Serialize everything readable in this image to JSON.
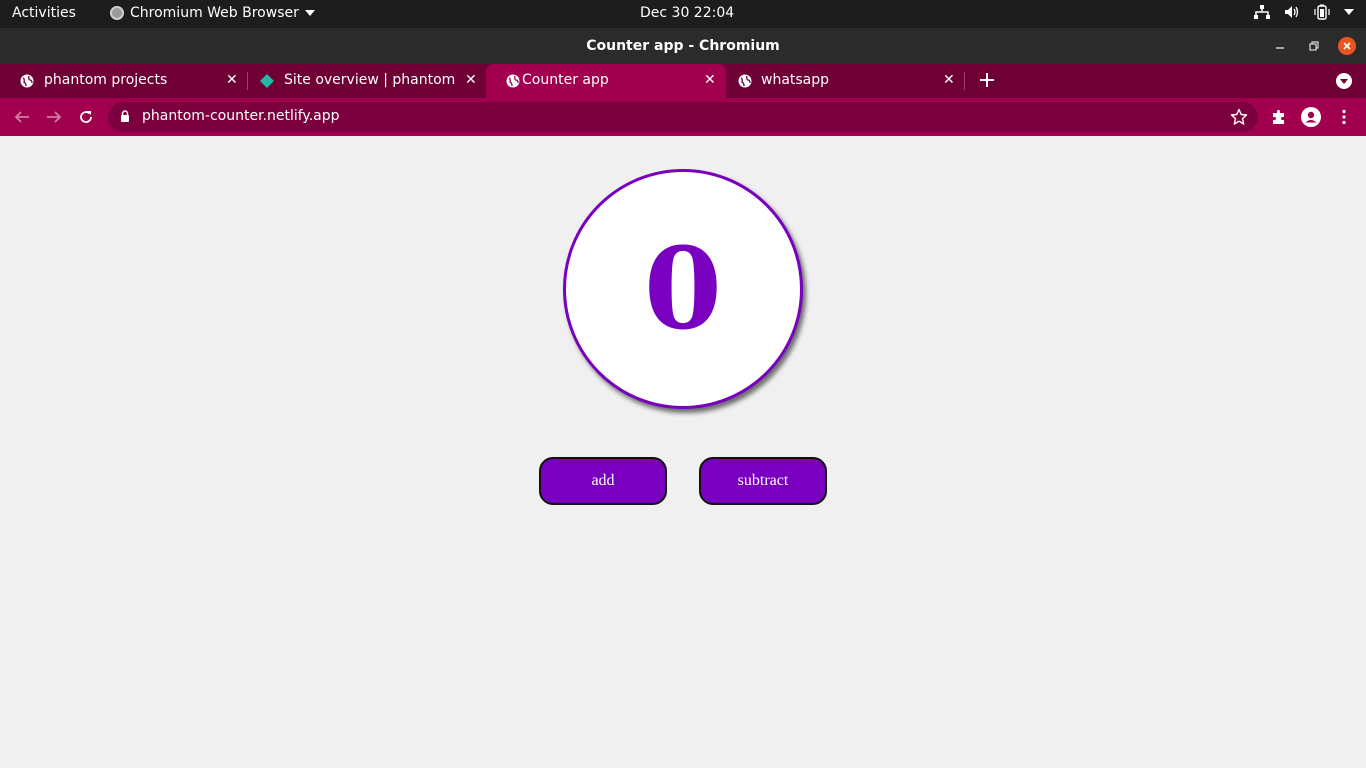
{
  "system_bar": {
    "activities": "Activities",
    "app_name": "Chromium Web Browser",
    "clock": "Dec 30  22:04",
    "tray_icons": [
      "network-icon",
      "volume-icon",
      "battery-icon",
      "system-menu-caret-icon"
    ]
  },
  "window": {
    "title": "Counter app - Chromium"
  },
  "tabs": [
    {
      "title": "phantom projects",
      "favicon": "globe-icon",
      "active": false
    },
    {
      "title": "Site overview | phantom-c",
      "favicon": "netlify-diamond-icon",
      "active": false
    },
    {
      "title": "Counter app",
      "favicon": "globe-icon",
      "active": true
    },
    {
      "title": "whatsapp",
      "favicon": "globe-icon",
      "active": false
    }
  ],
  "toolbar": {
    "url": "phantom-counter.netlify.app"
  },
  "counter": {
    "value": "0",
    "add_label": "add",
    "subtract_label": "subtract"
  },
  "colors": {
    "accent_purple": "#7a00c0",
    "tabstrip": "#6f0035",
    "toolbar": "#a0004d",
    "close_orange": "#e95420"
  }
}
